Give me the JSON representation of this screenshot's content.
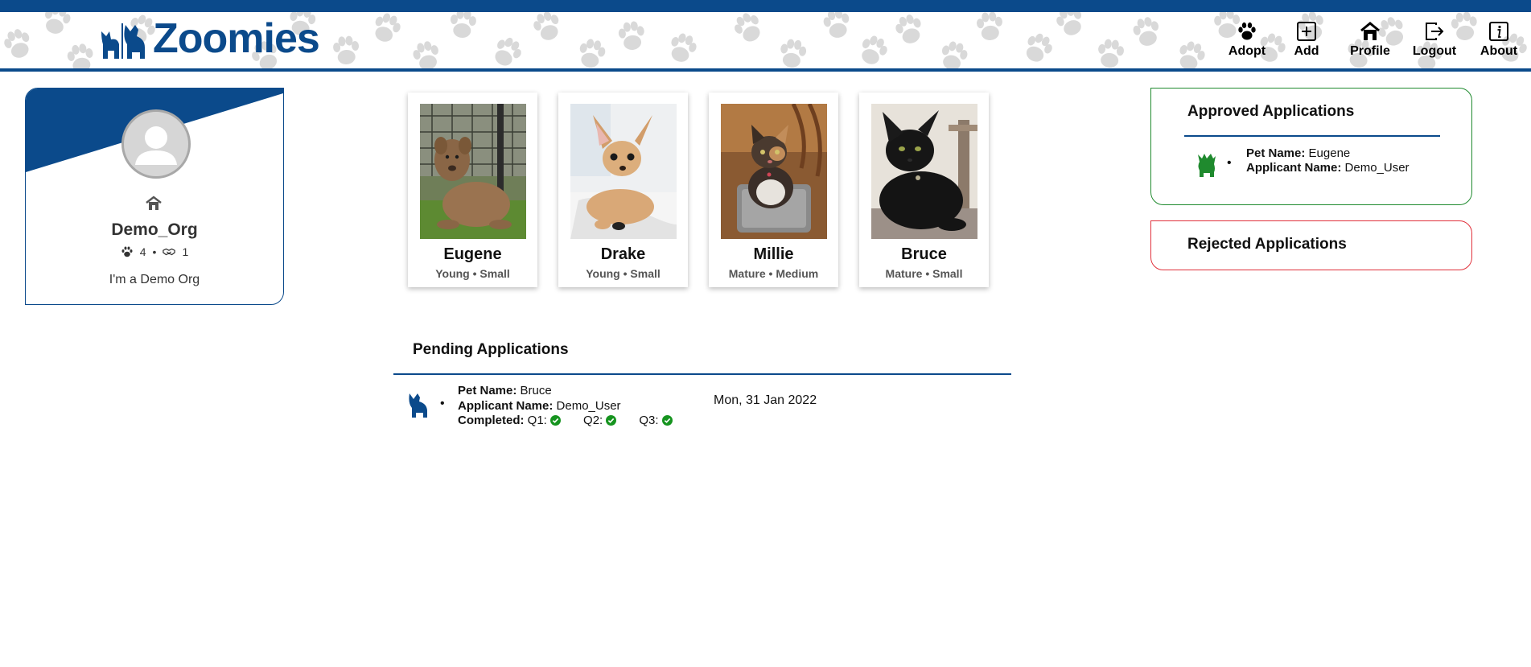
{
  "header": {
    "brand_name": "Zoomies",
    "nav": [
      {
        "label": "Adopt",
        "icon": "paw-icon"
      },
      {
        "label": "Add",
        "icon": "plus-square-icon"
      },
      {
        "label": "Profile",
        "icon": "house-icon"
      },
      {
        "label": "Logout",
        "icon": "logout-icon"
      },
      {
        "label": "About",
        "icon": "info-icon"
      }
    ]
  },
  "profile": {
    "org_name": "Demo_Org",
    "pet_count": "4",
    "separator": "•",
    "adoption_count": "1",
    "bio": "I'm a Demo Org"
  },
  "pets": [
    {
      "name": "Eugene",
      "meta": "Young • Small"
    },
    {
      "name": "Drake",
      "meta": "Young • Small"
    },
    {
      "name": "Millie",
      "meta": "Mature • Medium"
    },
    {
      "name": "Bruce",
      "meta": "Mature • Small"
    }
  ],
  "pending": {
    "title": "Pending Applications",
    "applications": [
      {
        "bullet": "•",
        "pet_name_label": "Pet Name:",
        "pet_name": "Bruce",
        "applicant_label": "Applicant Name:",
        "applicant": "Demo_User",
        "completed_label": "Completed:",
        "q1": "Q1:",
        "q2": "Q2:",
        "q3": "Q3:",
        "date": "Mon, 31 Jan 2022"
      }
    ]
  },
  "approved": {
    "title": "Approved Applications",
    "applications": [
      {
        "bullet": "•",
        "pet_name_label": "Pet Name:",
        "pet_name": "Eugene",
        "applicant_label": "Applicant Name:",
        "applicant": "Demo_User"
      }
    ]
  },
  "rejected": {
    "title": "Rejected Applications"
  },
  "colors": {
    "brand_blue": "#0b4a8b",
    "approved_green": "#1f8a2e",
    "rejected_red": "#e0303a",
    "check_green": "#16941f"
  }
}
